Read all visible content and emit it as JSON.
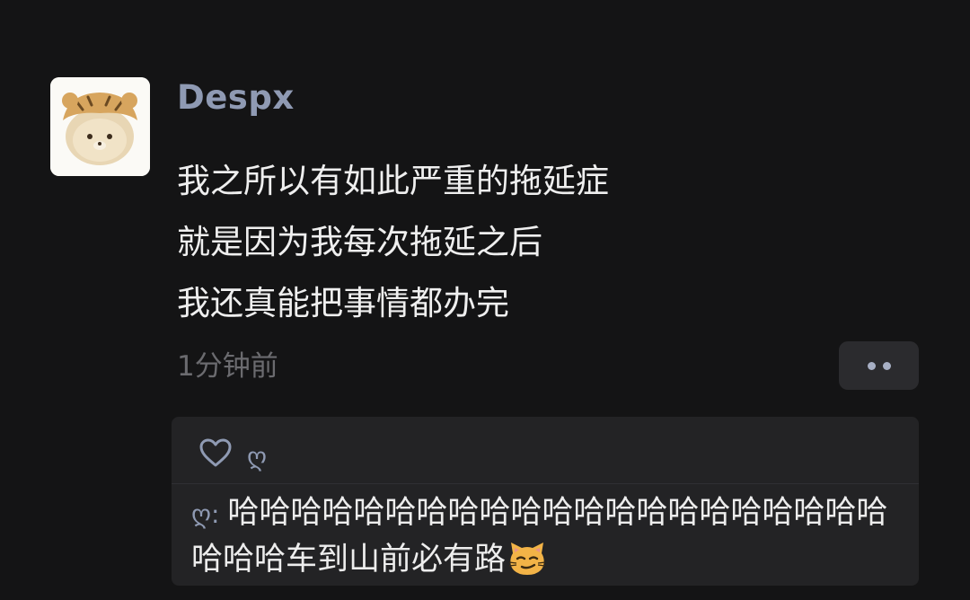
{
  "post": {
    "username": "Despx",
    "avatar_icon": "bear-in-tiger-hat-icon",
    "lines": [
      "我之所以有如此严重的拖延症",
      "就是因为我每次拖延之后",
      "我还真能把事情都办完"
    ],
    "timestamp": "1分钟前",
    "more_icon": "two-dots-icon"
  },
  "interactions": {
    "like_icon": "heart-outline-icon",
    "liker": "ღ",
    "comment": {
      "author": "ღ",
      "separator": ": ",
      "text": "哈哈哈哈哈哈哈哈哈哈哈哈哈哈哈哈哈哈哈哈哈哈哈哈车到山前必有路",
      "emoji_icon": "smirking-cat-emoji-icon"
    }
  },
  "colors": {
    "background": "#141415",
    "name_accent": "#8f9ab3",
    "panel": "#232325",
    "muted_text": "#6b6b6f"
  }
}
